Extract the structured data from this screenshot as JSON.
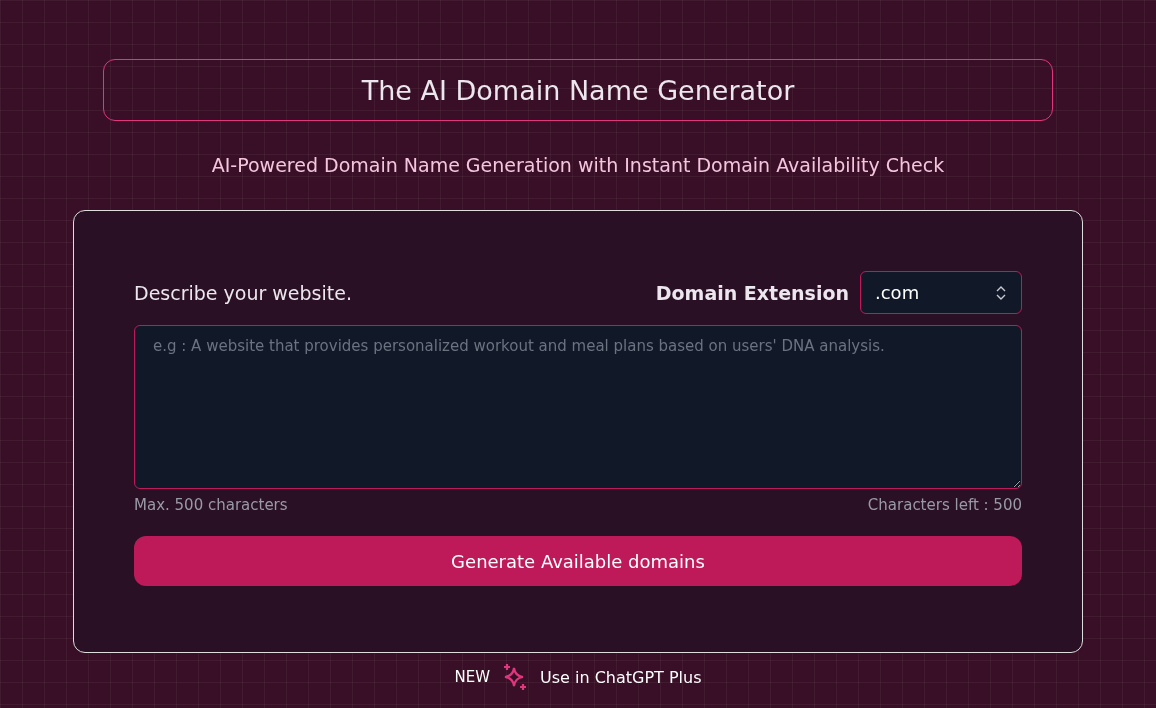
{
  "header": {
    "title": "The AI Domain Name Generator",
    "subtitle": "AI-Powered Domain Name Generation with Instant Domain Availability Check"
  },
  "form": {
    "description_label": "Describe your website.",
    "extension_label": "Domain Extension",
    "extension_value": ".com",
    "description_field": {
      "placeholder": "e.g : A website that provides personalized workout and meal plans based on users' DNA analysis."
    },
    "max_note": "Max. 500 characters",
    "counter": "Characters left : 500",
    "submit": "Generate Available domains"
  },
  "footer": {
    "badge": "NEW",
    "link": "Use in ChatGPT Plus"
  }
}
